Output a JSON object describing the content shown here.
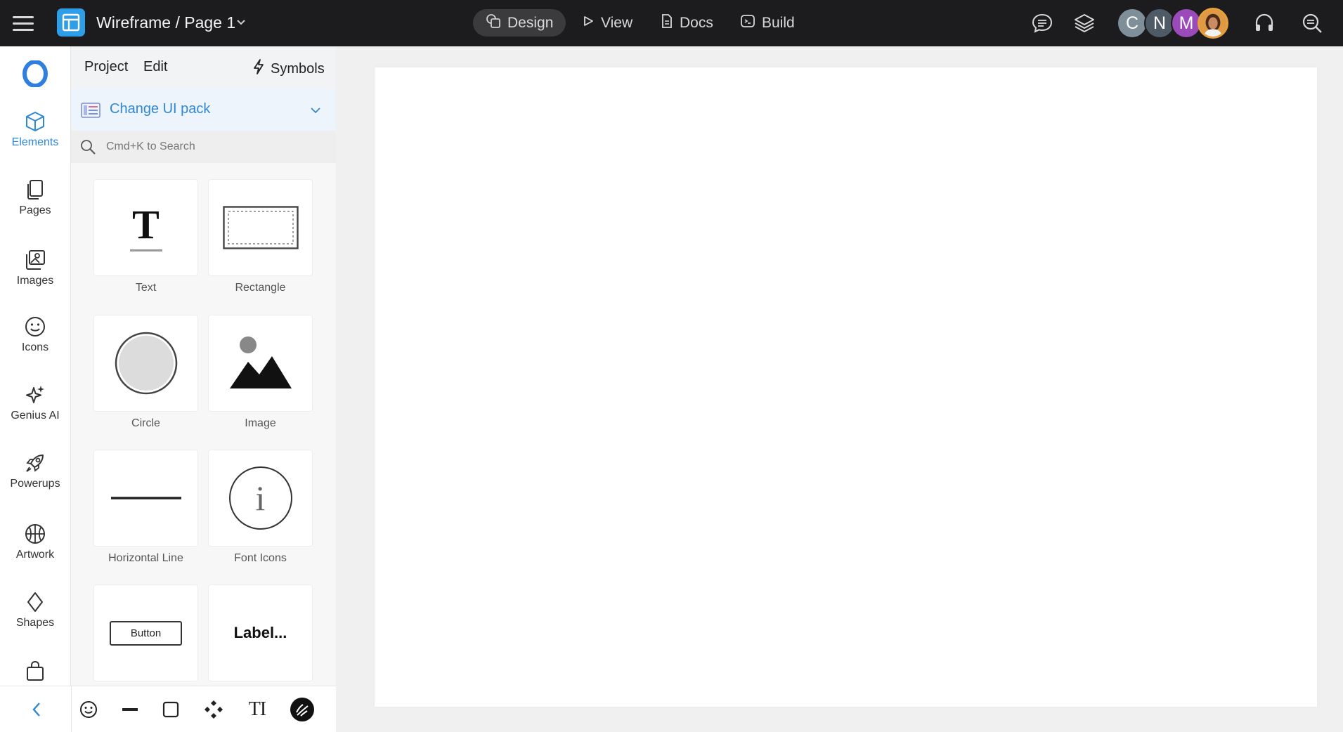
{
  "topbar": {
    "title": "Wireframe / Page 1",
    "modes": [
      {
        "label": "Design",
        "icon": "design-icon"
      },
      {
        "label": "View",
        "icon": "play-icon"
      },
      {
        "label": "Docs",
        "icon": "document-icon"
      },
      {
        "label": "Build",
        "icon": "terminal-icon"
      }
    ],
    "collaborators": [
      "C",
      "N",
      "M"
    ],
    "icons": [
      "menu-icon",
      "app-logo-icon",
      "chevron-down-icon",
      "comments-icon",
      "layers-icon",
      "headset-icon",
      "zoom-icon"
    ]
  },
  "rail": {
    "items": [
      {
        "label": "Elements",
        "icon": "cube-icon"
      },
      {
        "label": "Pages",
        "icon": "pages-icon"
      },
      {
        "label": "Images",
        "icon": "images-icon"
      },
      {
        "label": "Icons",
        "icon": "smiley-icon"
      },
      {
        "label": "Genius AI",
        "icon": "sparkle-icon"
      },
      {
        "label": "Powerups",
        "icon": "rocket-icon"
      },
      {
        "label": "Artwork",
        "icon": "basketball-icon"
      },
      {
        "label": "Shapes",
        "icon": "diamond-icon"
      }
    ]
  },
  "panel": {
    "menu": {
      "project": "Project",
      "edit": "Edit",
      "symbols": "Symbols"
    },
    "ui_pack": "Change UI pack",
    "search_placeholder": "Cmd+K to Search",
    "elements": [
      "Text",
      "Rectangle",
      "Circle",
      "Image",
      "Horizontal Line",
      "Font Icons"
    ],
    "button_preview": "Button",
    "label_preview": "Label...",
    "text_glyph": "T",
    "info_glyph": "i"
  },
  "bottom_toolbar": {
    "tools": [
      "chevron-left-icon",
      "smiley-icon",
      "line-icon",
      "square-icon",
      "component-icon",
      "text-tool-icon",
      "draw-icon"
    ],
    "text_tool_glyph": "TI"
  },
  "colors": {
    "topbar_bg": "#1c1c1e",
    "accent": "#2f88d6",
    "logo": "#2f9ee8",
    "canvas_bg": "#f0f0f0",
    "artboard": "#ffffff"
  }
}
